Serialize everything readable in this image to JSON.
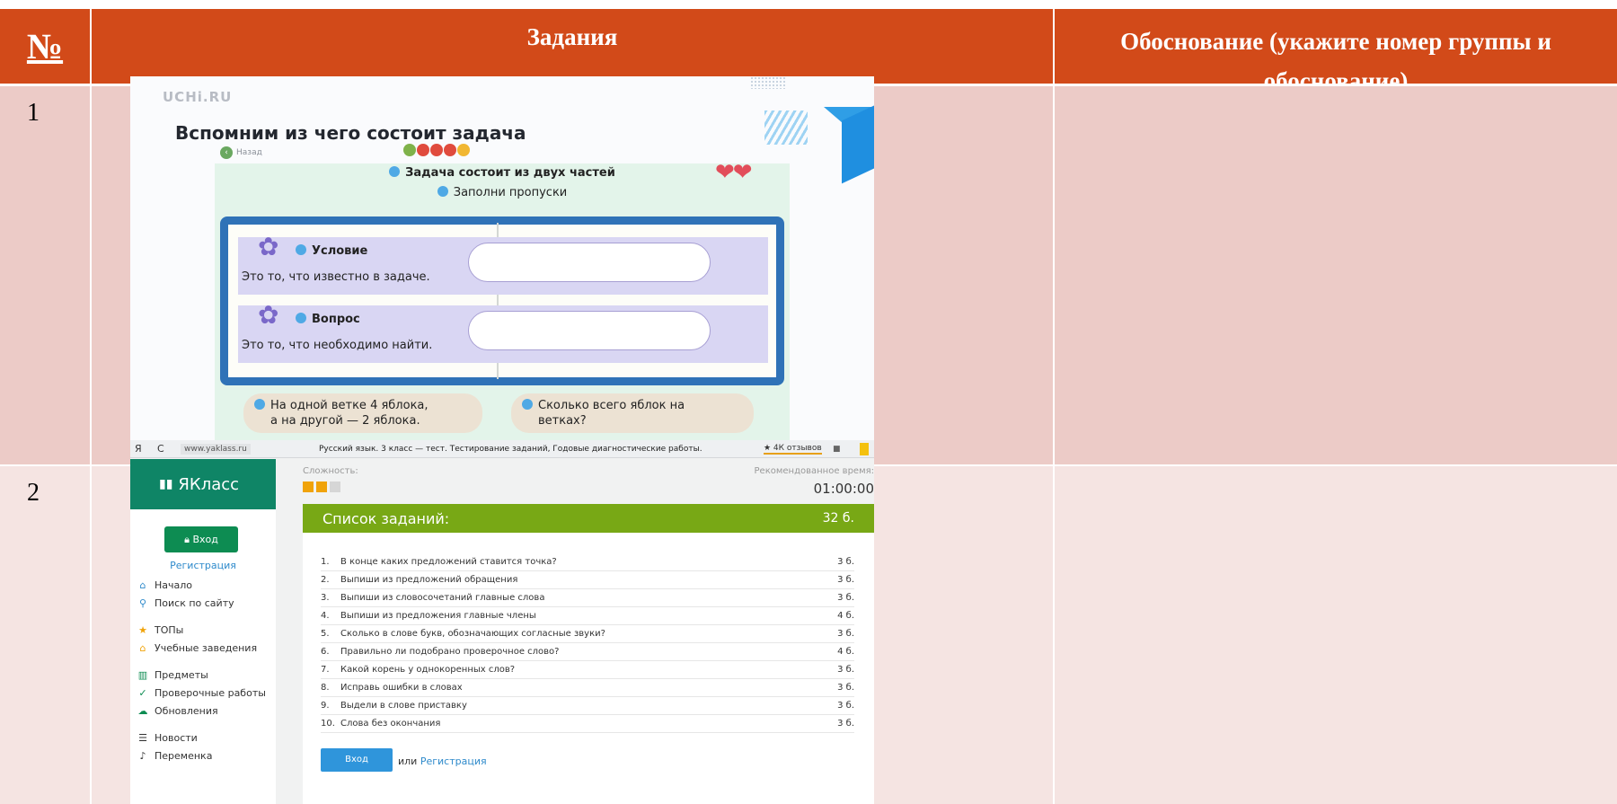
{
  "table": {
    "header": {
      "num": "№",
      "tasks": "Задания",
      "justification": "Обоснование (укажите номер группы  и обоснование)"
    },
    "rows": [
      {
        "num": "1"
      },
      {
        "num": "2"
      }
    ]
  },
  "uchi": {
    "logo": "UCHi.RU",
    "title": "Вспомним из чего состоит задача",
    "back": "Назад",
    "heading": "Задача состоит из двух частей",
    "instruction": "Заполни пропуски",
    "hearts": "❤❤",
    "parts": [
      {
        "name": "Условие",
        "desc": "Это то, что известно в задаче."
      },
      {
        "name": "Вопрос",
        "desc": "Это то, что необходимо найти."
      }
    ],
    "cards": [
      {
        "line1": "На одной ветке 4 яблока,",
        "line2": "а на другой — 2 яблока."
      },
      {
        "line1": "Сколько всего яблок на",
        "line2": "ветках?"
      }
    ]
  },
  "yaklass": {
    "browser": {
      "back": "Я",
      "reload": "C",
      "url": "www.yaklass.ru",
      "page_title": "Русский язык. 3 класс — тест. Тестирование заданий, Годовые диагностические работы.",
      "reviews": "★ 4К отзывов",
      "bookmark": "■"
    },
    "brand": "ЯКласс",
    "login": "Вход",
    "register": "Регистрация",
    "menu": [
      {
        "icon": "home-icon",
        "glyph": "⌂",
        "label": "Начало",
        "color": "#2e8acb"
      },
      {
        "icon": "search-icon",
        "glyph": "⚲",
        "label": "Поиск по сайту",
        "color": "#2e8acb"
      },
      {
        "icon": "star-icon",
        "glyph": "★",
        "label": "ТОПы",
        "color": "#f0a30a"
      },
      {
        "icon": "school-icon",
        "glyph": "⌂",
        "label": "Учебные заведения",
        "color": "#f0a30a"
      },
      {
        "icon": "books-icon",
        "glyph": "▥",
        "label": "Предметы",
        "color": "#0d8c52"
      },
      {
        "icon": "check-icon",
        "glyph": "✓",
        "label": "Проверочные работы",
        "color": "#0d8c52"
      },
      {
        "icon": "cloud-icon",
        "glyph": "☁",
        "label": "Обновления",
        "color": "#0d8c52"
      },
      {
        "icon": "news-icon",
        "glyph": "☰",
        "label": "Новости",
        "color": "#333333"
      },
      {
        "icon": "bell-icon",
        "glyph": "♪",
        "label": "Переменка",
        "color": "#333333"
      }
    ],
    "difficulty_label": "Сложность:",
    "difficulty": 2,
    "time_label": "Рекомендованное время:",
    "time": "01:00:00",
    "list_title": "Список заданий:",
    "total_points": "32 б.",
    "tasks": [
      {
        "n": "1.",
        "text": "В конце каких предложений ставится точка?",
        "pts": "3 б."
      },
      {
        "n": "2.",
        "text": "Выпиши из предложений обращения",
        "pts": "3 б."
      },
      {
        "n": "3.",
        "text": "Выпиши из словосочетаний главные слова",
        "pts": "3 б."
      },
      {
        "n": "4.",
        "text": "Выпиши из предложения главные члены",
        "pts": "4 б."
      },
      {
        "n": "5.",
        "text": "Сколько в слове букв, обозначающих согласные звуки?",
        "pts": "3 б."
      },
      {
        "n": "6.",
        "text": "Правильно ли подобрано проверочное слово?",
        "pts": "4 б."
      },
      {
        "n": "7.",
        "text": "Какой корень у однокоренных слов?",
        "pts": "3 б."
      },
      {
        "n": "8.",
        "text": "Исправь ошибки в словах",
        "pts": "3 б."
      },
      {
        "n": "9.",
        "text": "Выдели в слове приставку",
        "pts": "3 б."
      },
      {
        "n": "10.",
        "text": "Слова без окончания",
        "pts": "3 б."
      }
    ],
    "bottom_login": "Вход",
    "or": "или",
    "bottom_register": "Регистрация"
  }
}
